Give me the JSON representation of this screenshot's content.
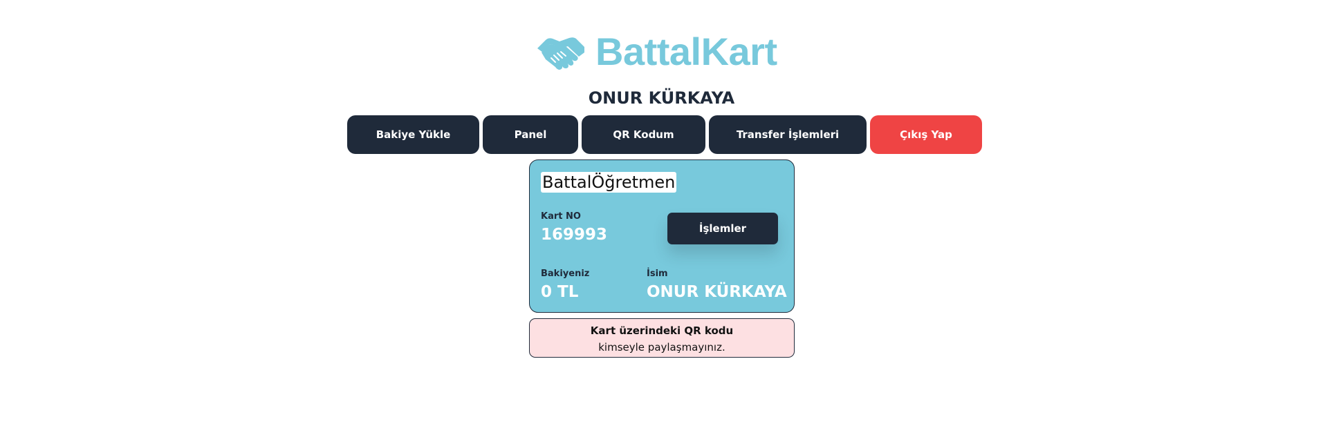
{
  "brand": {
    "name": "BattalKart",
    "logo_icon": "handshake-icon",
    "color": "#78c9dc"
  },
  "user": {
    "display_name": "ONUR KÜRKAYA"
  },
  "nav": {
    "items": [
      {
        "label": "Bakiye Yükle"
      },
      {
        "label": "Panel"
      },
      {
        "label": "QR Kodum"
      },
      {
        "label": "Transfer İşlemleri"
      },
      {
        "label": "Çıkış Yap"
      }
    ],
    "button_color": "#1f2a3a",
    "logout_color": "#ef4444"
  },
  "card": {
    "brand": "BattalÖğretmen",
    "card_no_label": "Kart NO",
    "card_no": "169993",
    "action_label": "İşlemler",
    "balance_label": "Bakiyeniz",
    "balance": "0 TL",
    "name_label": "İsim",
    "name": "ONUR KÜRKAYA",
    "color": "#78c9dc"
  },
  "warning": {
    "line1": "Kart üzerindeki QR kodu",
    "line2": "kimseyle paylaşmayınız.",
    "background": "#fde0e2"
  }
}
